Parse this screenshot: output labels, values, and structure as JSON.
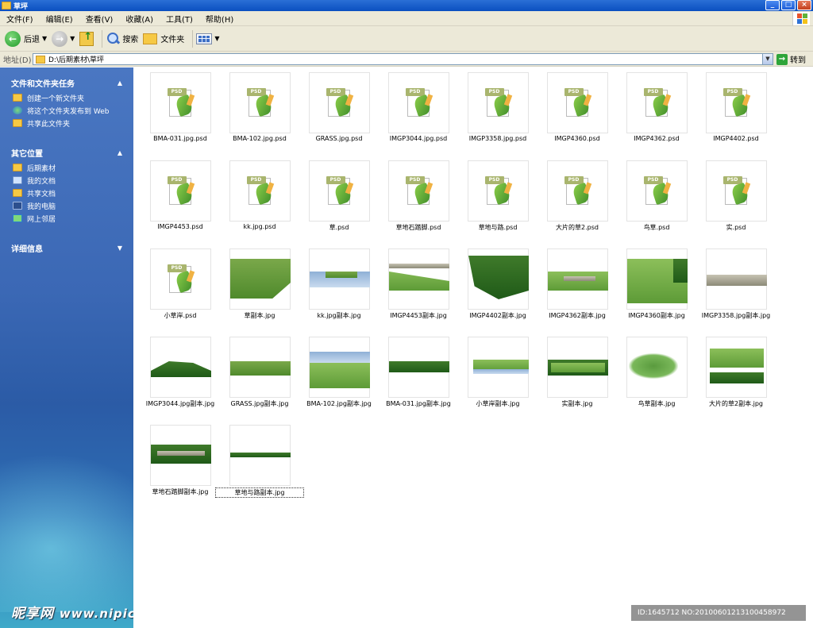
{
  "window": {
    "title": "草坪"
  },
  "menu": [
    "文件(F)",
    "编辑(E)",
    "查看(V)",
    "收藏(A)",
    "工具(T)",
    "帮助(H)"
  ],
  "toolbar": {
    "back": "后退",
    "search": "搜索",
    "folders": "文件夹"
  },
  "address": {
    "label": "地址(D)",
    "path": "D:\\后期素材\\草坪",
    "go": "转到"
  },
  "sidebar": {
    "tasks_title": "文件和文件夹任务",
    "tasks": [
      "创建一个新文件夹",
      "将这个文件夹发布到 Web",
      "共享此文件夹"
    ],
    "places_title": "其它位置",
    "places": [
      "后期素材",
      "我的文档",
      "共享文档",
      "我的电脑",
      "网上邻居"
    ],
    "details_title": "详细信息"
  },
  "files": [
    "BMA-031.jpg.psd",
    "BMA-102.jpg.psd",
    "GRASS.jpg.psd",
    "IMGP3044.jpg.psd",
    "IMGP3358.jpg.psd",
    "IMGP4360.psd",
    "IMGP4362.psd",
    "IMGP4402.psd",
    "IMGP4453.psd",
    "kk.jpg.psd",
    "草.psd",
    "草地石踏脚.psd",
    "草地与路.psd",
    "大片的草2.psd",
    "鸟草.psd",
    "实.psd",
    "小草岸.psd",
    "草副本.jpg",
    "kk.jpg副本.jpg",
    "IMGP4453副本.jpg",
    "IMGP4402副本.jpg",
    "IMGP4362副本.jpg",
    "IMGP4360副本.jpg",
    "IMGP3358.jpg副本.jpg",
    "IMGP3044.jpg副本.jpg",
    "GRASS.jpg副本.jpg",
    "BMA-102.jpg副本.jpg",
    "BMA-031.jpg副本.jpg",
    "小草岸副本.jpg",
    "实副本.jpg",
    "鸟草副本.jpg",
    "大片的草2副本.jpg",
    "草地石踏脚副本.jpg",
    "草地与路副本.jpg"
  ],
  "watermark": {
    "brand": "昵享网",
    "url": "www.nipic.cn"
  },
  "stamp": "ID:1645712 NO:20100601213100458972"
}
